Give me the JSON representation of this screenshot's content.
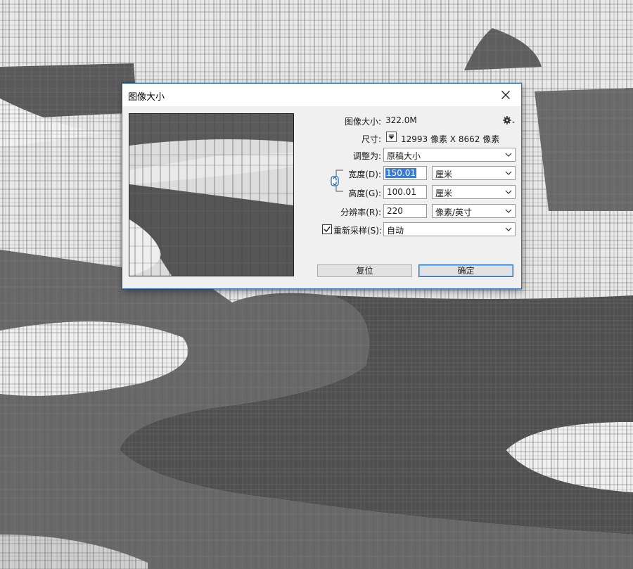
{
  "dialog": {
    "title": "图像大小",
    "image_size_label": "图像大小:",
    "image_size_value": "322.0M",
    "dimensions_label": "尺寸:",
    "dimensions_value": "12993 像素  X  8662 像素",
    "fit_to_label": "调整为:",
    "fit_to_value": "原稿大小",
    "width_label": "宽度(D):",
    "width_value": "150.01",
    "width_unit": "厘米",
    "height_label": "高度(G):",
    "height_value": "100.01",
    "height_unit": "厘米",
    "resolution_label": "分辨率(R):",
    "resolution_value": "220",
    "resolution_unit": "像素/英寸",
    "resample_label": "重新采样(S):",
    "resample_checked": true,
    "resample_value": "自动",
    "reset_button": "复位",
    "ok_button": "确定"
  },
  "icons": [
    "close-icon",
    "gear-icon",
    "dropdown-triangle-icon",
    "chevron-down-icon",
    "link-icon",
    "checkmark-icon"
  ],
  "colors": {
    "accent": "#0f6fcf",
    "selection": "#3b7bd0",
    "dark_band": "#5a5a5a",
    "light_band": "#eeeeee"
  }
}
